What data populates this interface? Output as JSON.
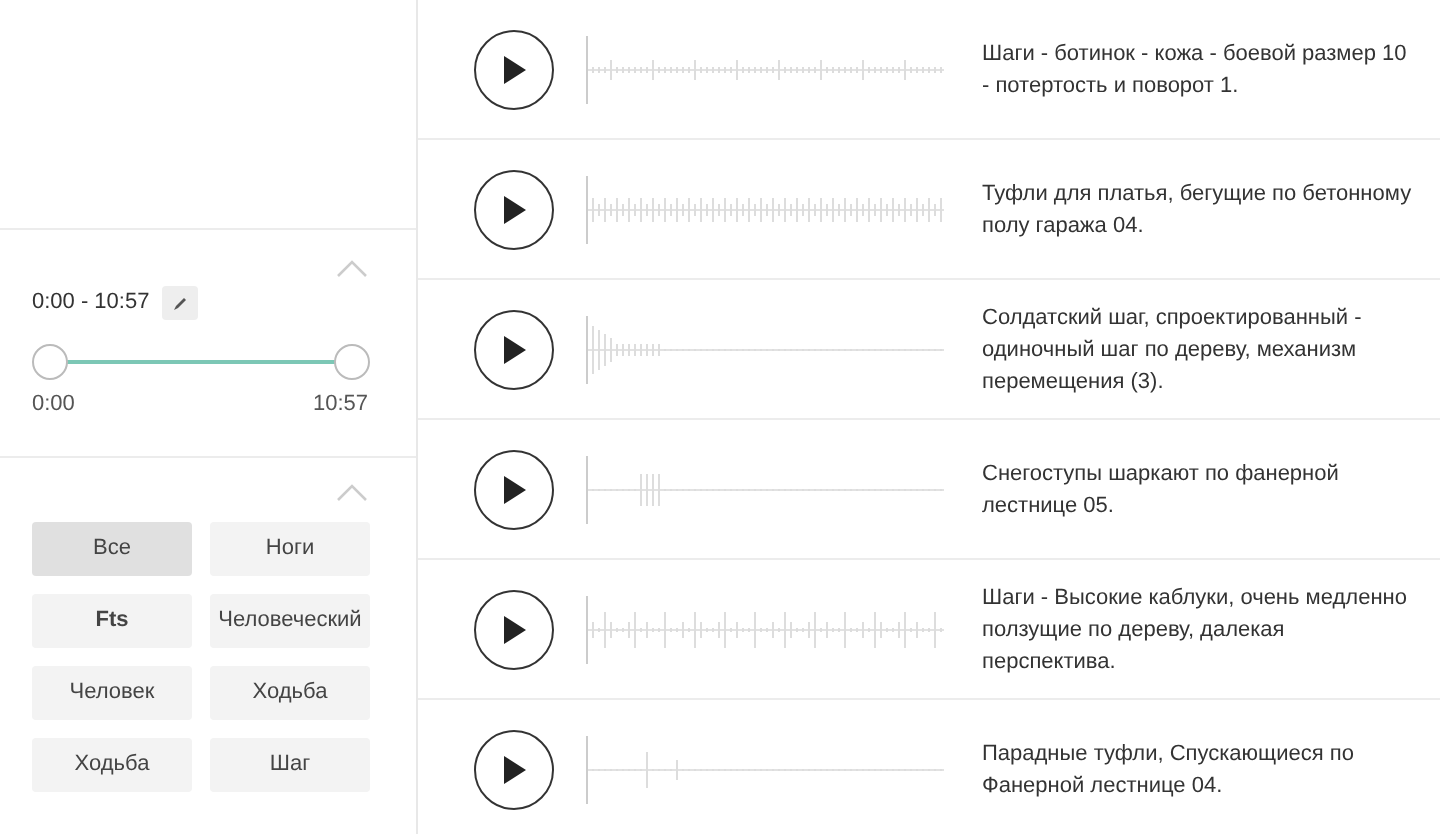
{
  "duration_filter": {
    "range_text": "0:00 - 10:57",
    "start_handle": {
      "level": 0
    },
    "end_handle": {
      "level": 1
    },
    "min_label": "0:00",
    "max_label": "10:57"
  },
  "tags": [
    {
      "label": "Все",
      "selected": true,
      "bold": false
    },
    {
      "label": "Ноги",
      "selected": false,
      "bold": false
    },
    {
      "label": "Fts",
      "selected": false,
      "bold": true
    },
    {
      "label": "Человеческий",
      "selected": false,
      "bold": false
    },
    {
      "label": "Человек",
      "selected": false,
      "bold": false
    },
    {
      "label": "Ходьба",
      "selected": false,
      "bold": false
    },
    {
      "label": "Ходьба",
      "selected": false,
      "bold": false
    },
    {
      "label": "Шаг",
      "selected": false,
      "bold": false
    }
  ],
  "sounds": [
    {
      "description": "Шаги - ботинок - кожа - боевой размер 10 - потертость и поворот 1."
    },
    {
      "description": "Туфли для платья, бегущие по бетонному полу гаража 04."
    },
    {
      "description": "Солдатский шаг, спроектированный - одиночный шаг по дереву, механизм перемещения (3)."
    },
    {
      "description": "Снегоступы шаркают по фанерной лестнице 05."
    },
    {
      "description": "Шаги - Высокие каблуки, очень медленно ползущие по дереву, далекая перспектива."
    },
    {
      "description": "Парадные туфли, Спускающиеся по Фанерной лестнице 04."
    }
  ]
}
